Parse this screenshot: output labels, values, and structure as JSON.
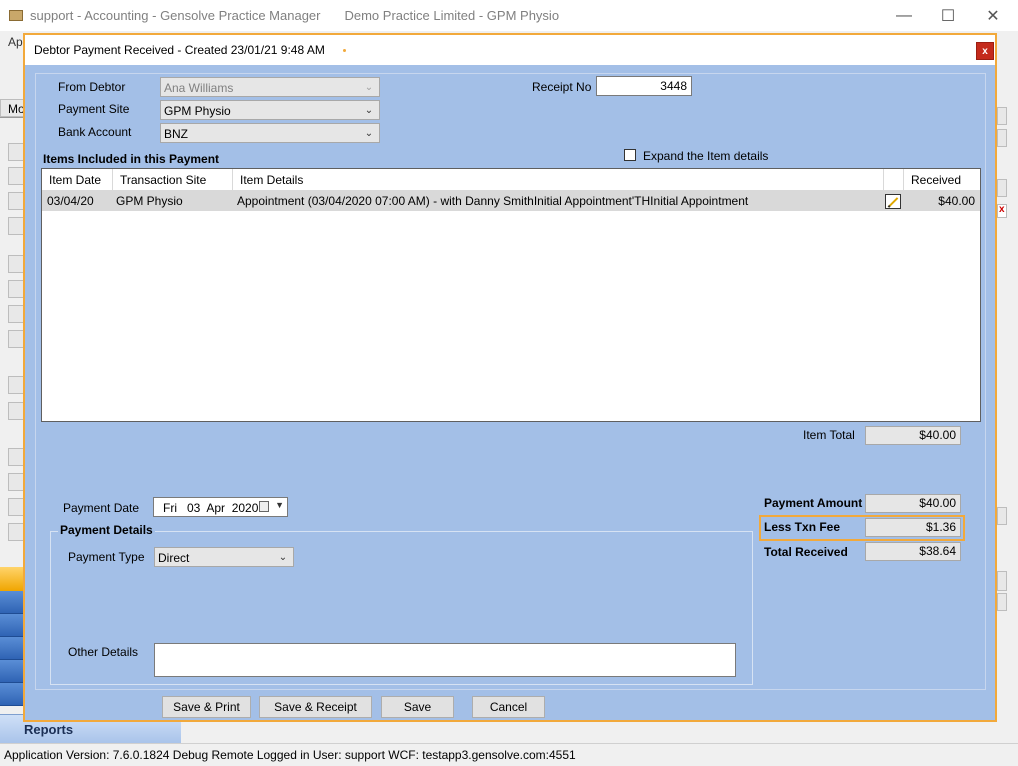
{
  "main_window": {
    "title": "support - Accounting - Gensolve Practice Manager",
    "practice": "Demo Practice Limited  - GPM Physio",
    "minimize": "—",
    "maximize": "☐",
    "close": "✕",
    "menu_partial": "Ap",
    "tab_partial": "Mo",
    "nav_reports": "Reports"
  },
  "status_bar": {
    "text": "Application Version: 7.6.0.1824 Debug Remote  Logged in User: support WCF: testapp3.gensolve.com:4551"
  },
  "dialog": {
    "title": "Debtor Payment Received - Created 23/01/21 9:48 AM",
    "close_label": "x",
    "from_debtor_label": "From Debtor",
    "from_debtor_value": "Ana Williams",
    "payment_site_label": "Payment Site",
    "payment_site_value": "GPM Physio",
    "bank_account_label": "Bank Account",
    "bank_account_value": "BNZ",
    "receipt_no_label": "Receipt No",
    "receipt_no_value": "3448",
    "items_heading": "Items Included in this Payment",
    "expand_label": "Expand the Item details",
    "expand_checked": false,
    "grid": {
      "columns": [
        "Item Date",
        "Transaction Site",
        "Item Details",
        "Received"
      ],
      "rows": [
        {
          "date": "03/04/20",
          "site": "GPM Physio",
          "details": "Appointment (03/04/2020 07:00 AM) -  with Danny SmithInitial Appointment'THInitial Appointment",
          "received": "$40.00"
        }
      ]
    },
    "item_total_label": "Item Total",
    "item_total_value": "$40.00",
    "payment_date_label": "Payment Date",
    "payment_date_value": "Fri   03  Apr  2020",
    "payment_details_heading": "Payment Details",
    "payment_type_label": "Payment Type",
    "payment_type_value": "Direct",
    "other_details_label": "Other Details",
    "other_details_value": "",
    "payment_amount_label": "Payment Amount",
    "payment_amount_value": "$40.00",
    "less_fee_label": "Less Txn Fee",
    "less_fee_value": "$1.36",
    "total_received_label": "Total Received",
    "total_received_value": "$38.64",
    "buttons": {
      "save_print": "Save & Print",
      "save_receipt": "Save & Receipt",
      "save": "Save",
      "cancel": "Cancel"
    }
  }
}
